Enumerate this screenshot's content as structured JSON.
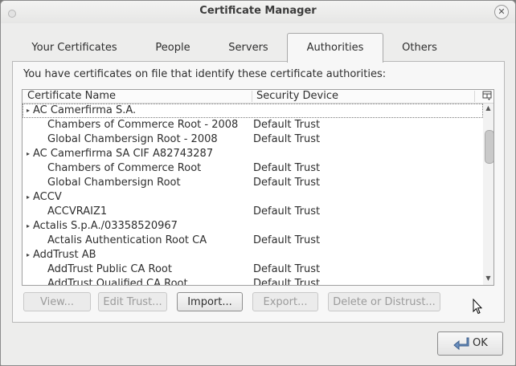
{
  "window": {
    "title": "Certificate Manager"
  },
  "tabs": [
    {
      "label": "Your Certificates",
      "active": false
    },
    {
      "label": "People",
      "active": false
    },
    {
      "label": "Servers",
      "active": false
    },
    {
      "label": "Authorities",
      "active": true
    },
    {
      "label": "Others",
      "active": false
    }
  ],
  "description": "You have certificates on file that identify these certificate authorities:",
  "table": {
    "columns": [
      "Certificate Name",
      "Security Device"
    ],
    "rows": [
      {
        "name": "AC Camerfirma S.A.",
        "device": "",
        "group": true
      },
      {
        "name": "Chambers of Commerce Root - 2008",
        "device": "Default Trust",
        "group": false
      },
      {
        "name": "Global Chambersign Root - 2008",
        "device": "Default Trust",
        "group": false
      },
      {
        "name": "AC Camerfirma SA CIF A82743287",
        "device": "",
        "group": true
      },
      {
        "name": "Chambers of Commerce Root",
        "device": "Default Trust",
        "group": false
      },
      {
        "name": "Global Chambersign Root",
        "device": "Default Trust",
        "group": false
      },
      {
        "name": "ACCV",
        "device": "",
        "group": true
      },
      {
        "name": "ACCVRAIZ1",
        "device": "Default Trust",
        "group": false
      },
      {
        "name": "Actalis S.p.A./03358520967",
        "device": "",
        "group": true
      },
      {
        "name": "Actalis Authentication Root CA",
        "device": "Default Trust",
        "group": false
      },
      {
        "name": "AddTrust AB",
        "device": "",
        "group": true
      },
      {
        "name": "AddTrust Public CA Root",
        "device": "Default Trust",
        "group": false
      },
      {
        "name": "AddTrust Qualified CA Root",
        "device": "Default Trust",
        "group": false
      }
    ]
  },
  "buttons": {
    "view": "View...",
    "edit_trust": "Edit Trust...",
    "import": "Import...",
    "export": "Export...",
    "delete": "Delete or Distrust..."
  },
  "ok_label": "OK"
}
